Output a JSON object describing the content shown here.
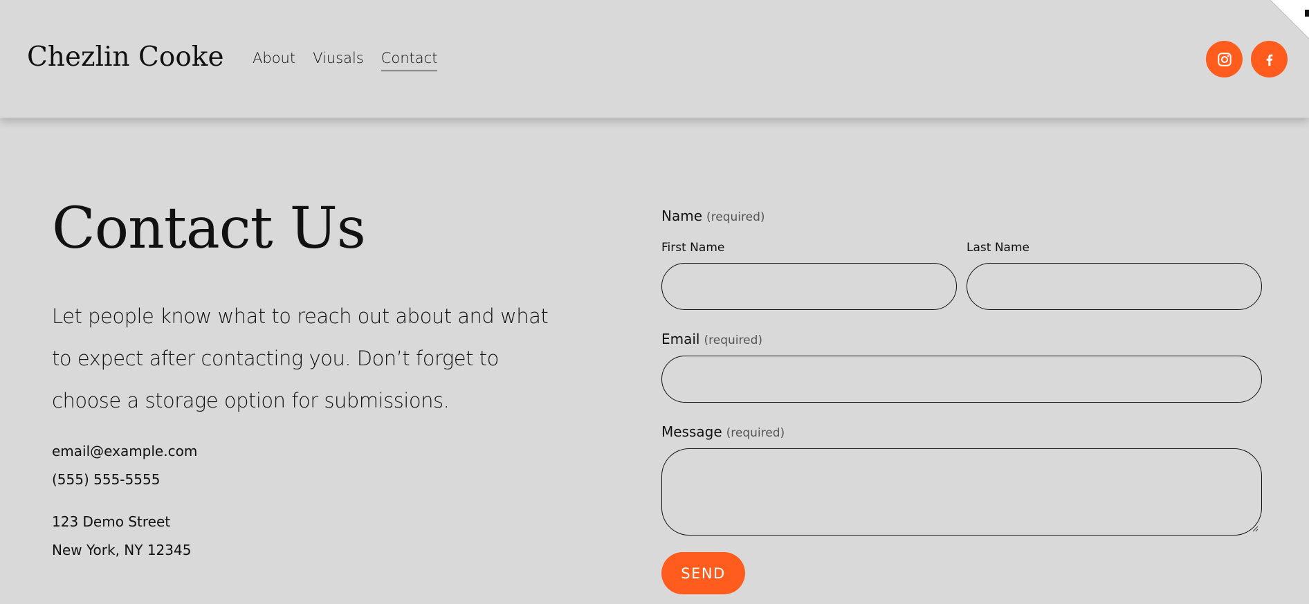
{
  "site": {
    "logo": "Chezlin Cooke",
    "accent_color": "#ff5c1e"
  },
  "nav": {
    "items": [
      {
        "label": "About",
        "active": false
      },
      {
        "label": "Viusals",
        "active": false
      },
      {
        "label": "Contact",
        "active": true
      }
    ]
  },
  "social": {
    "icons": [
      "instagram-icon",
      "facebook-icon"
    ]
  },
  "page": {
    "title": "Contact Us",
    "intro": "Let people know what to reach out about and what to expect after contacting you. Don’t forget to choose a storage option for submissions.",
    "email": "email@example.com",
    "phone": "(555) 555-5555",
    "address_line1": "123 Demo Street",
    "address_line2": "New York, NY 12345"
  },
  "form": {
    "name_label": "Name",
    "required_text": "(required)",
    "first_name_label": "First Name",
    "last_name_label": "Last Name",
    "email_label": "Email",
    "message_label": "Message",
    "send_label": "SEND"
  }
}
